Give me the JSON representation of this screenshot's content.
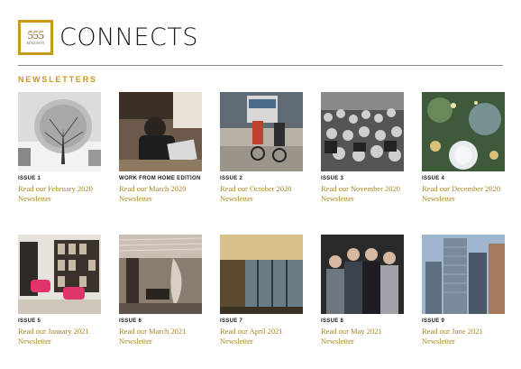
{
  "header": {
    "logo_number": "555",
    "logo_subtext": "MADISON",
    "brand_title": "CONNECTS"
  },
  "section": {
    "title": "NEWSLETTERS"
  },
  "colors": {
    "accent": "#c79a1c",
    "link": "#a88420",
    "rule": "#8c8c8c"
  },
  "issues": [
    {
      "label": "ISSUE 1",
      "link_line1": "Read our February 2020",
      "link_line2": "Newsletter",
      "image": "snowy-tree"
    },
    {
      "label": "WORK FROM HOME EDITION",
      "link_line1": "Read our March 2020",
      "link_line2": "Newsletter",
      "image": "laptop-work"
    },
    {
      "label": "ISSUE 2",
      "link_line1": "Read our October 2020",
      "link_line2": "Newsletter",
      "image": "cyclists-street"
    },
    {
      "label": "ISSUE 3",
      "link_line1": "Read our November 2020",
      "link_line2": "Newsletter",
      "image": "crowd"
    },
    {
      "label": "ISSUE 4",
      "link_line1": "Read our December 2020",
      "link_line2": "Newsletter",
      "image": "christmas-ornaments"
    },
    {
      "label": "ISSUE 5",
      "link_line1": "Read our January 2021",
      "link_line2": "Newsletter",
      "image": "lounge-bookshelf"
    },
    {
      "label": "ISSUE 6",
      "link_line1": "Read our March 2021",
      "link_line2": "Newsletter",
      "image": "lobby-sculpture"
    },
    {
      "label": "ISSUE 7",
      "link_line1": "Read our April 2021",
      "link_line2": "Newsletter",
      "image": "glass-lobby"
    },
    {
      "label": "ISSUE 8",
      "link_line1": "Read our May 2021",
      "link_line2": "Newsletter",
      "image": "four-men"
    },
    {
      "label": "ISSUE 9",
      "link_line1": "Read our June 2021",
      "link_line2": "Newsletter",
      "image": "skyscrapers"
    }
  ]
}
